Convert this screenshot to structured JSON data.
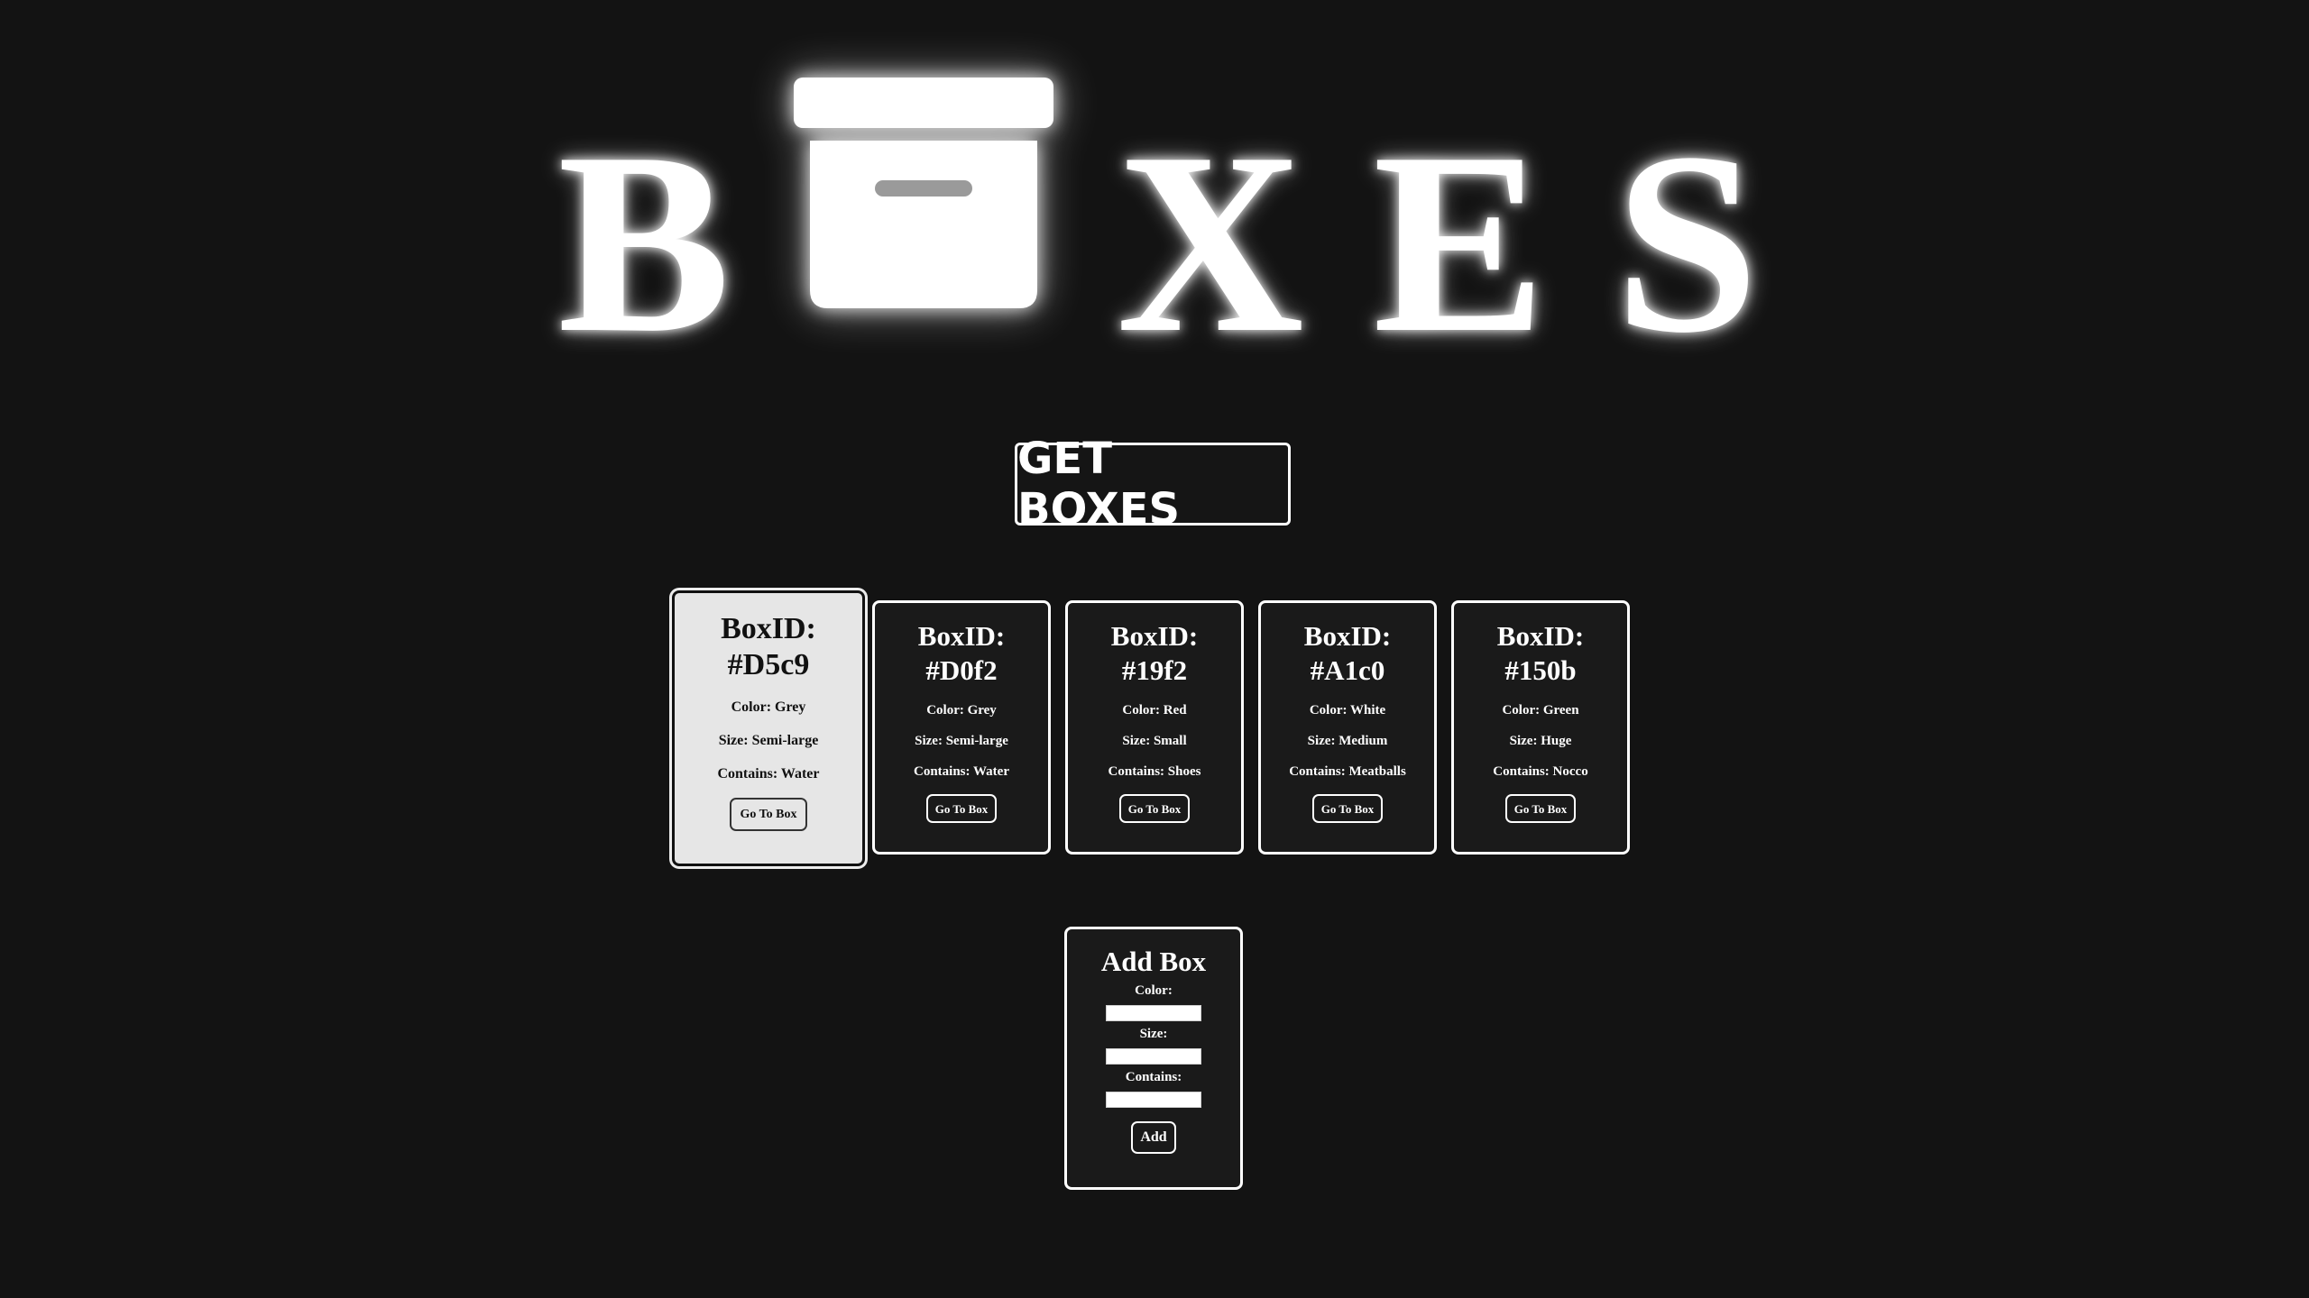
{
  "logo": {
    "letters": [
      "B",
      "X",
      "E",
      "S"
    ],
    "icon": "archive-box-icon"
  },
  "get_boxes_label": "GET BOXES",
  "boxes": [
    {
      "id": "BoxID:\n#D5c9",
      "color": "Color: Grey",
      "size": "Size: Semi-large",
      "contains": "Contains: Water",
      "button": "Go To Box",
      "hovered": true
    },
    {
      "id": "BoxID:\n#D0f2",
      "color": "Color: Grey",
      "size": "Size: Semi-large",
      "contains": "Contains: Water",
      "button": "Go To Box",
      "hovered": false
    },
    {
      "id": "BoxID:\n#19f2",
      "color": "Color: Red",
      "size": "Size: Small",
      "contains": "Contains: Shoes",
      "button": "Go To Box",
      "hovered": false
    },
    {
      "id": "BoxID:\n#A1c0",
      "color": "Color: White",
      "size": "Size: Medium",
      "contains": "Contains: Meatballs",
      "button": "Go To Box",
      "hovered": false
    },
    {
      "id": "BoxID:\n#150b",
      "color": "Color: Green",
      "size": "Size: Huge",
      "contains": "Contains: Nocco",
      "button": "Go To Box",
      "hovered": false
    }
  ],
  "add_box": {
    "title": "Add Box",
    "color_label": "Color:",
    "color_value": "",
    "size_label": "Size:",
    "size_value": "",
    "contains_label": "Contains:",
    "contains_value": "",
    "button": "Add"
  },
  "colors": {
    "background": "#131313",
    "card_background": "#1a1a1a",
    "active_card_background": "#e6e6e6",
    "foreground": "#ffffff"
  }
}
